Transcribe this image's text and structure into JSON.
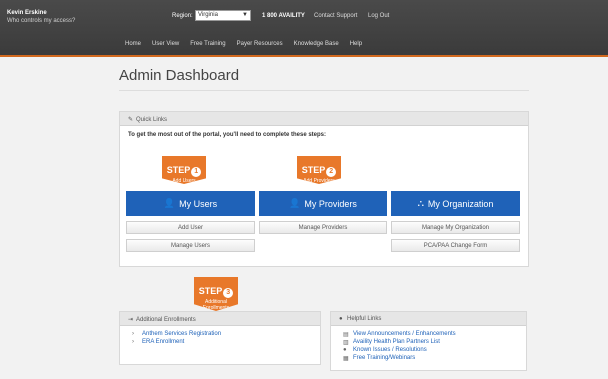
{
  "header": {
    "user_name": "Kevin Erskine",
    "user_sub": "Who controls my access?",
    "region_label": "Region:",
    "region_value": "Virginia",
    "phone": "1 800 AVAILITY",
    "contact": "Contact Support",
    "logout": "Log Out",
    "nav": [
      "Home",
      "User View",
      "Free Training",
      "Payer Resources",
      "Knowledge Base",
      "Help"
    ]
  },
  "page_title": "Admin Dashboard",
  "quick_links": {
    "title": "Quick Links",
    "instruction": "To get the most out of the portal, you'll need to complete these steps:",
    "step_word": "STEP",
    "steps": [
      {
        "num": "1",
        "sub": "Add Users"
      },
      {
        "num": "2",
        "sub": "Add Providers"
      }
    ],
    "cols": [
      {
        "label": "My Users",
        "buttons": [
          "Add User",
          "Manage Users"
        ]
      },
      {
        "label": "My Providers",
        "buttons": [
          "Manage Providers"
        ]
      },
      {
        "label": "My Organization",
        "buttons": [
          "Manage My Organization",
          "PCA/PAA Change Form"
        ]
      }
    ]
  },
  "step3": {
    "num": "3",
    "sub1": "Additional",
    "sub2": "Enrollments"
  },
  "additional_enrollments": {
    "title": "Additional Enrollments",
    "items": [
      "Anthem Services Registration",
      "ERA Enrollment"
    ]
  },
  "helpful_links": {
    "title": "Helpful Links",
    "items": [
      "View Announcements / Enhancements",
      "Availity Health Plan Partners List",
      "Known Issues / Resolutions",
      "Free Training/Webinars"
    ]
  }
}
